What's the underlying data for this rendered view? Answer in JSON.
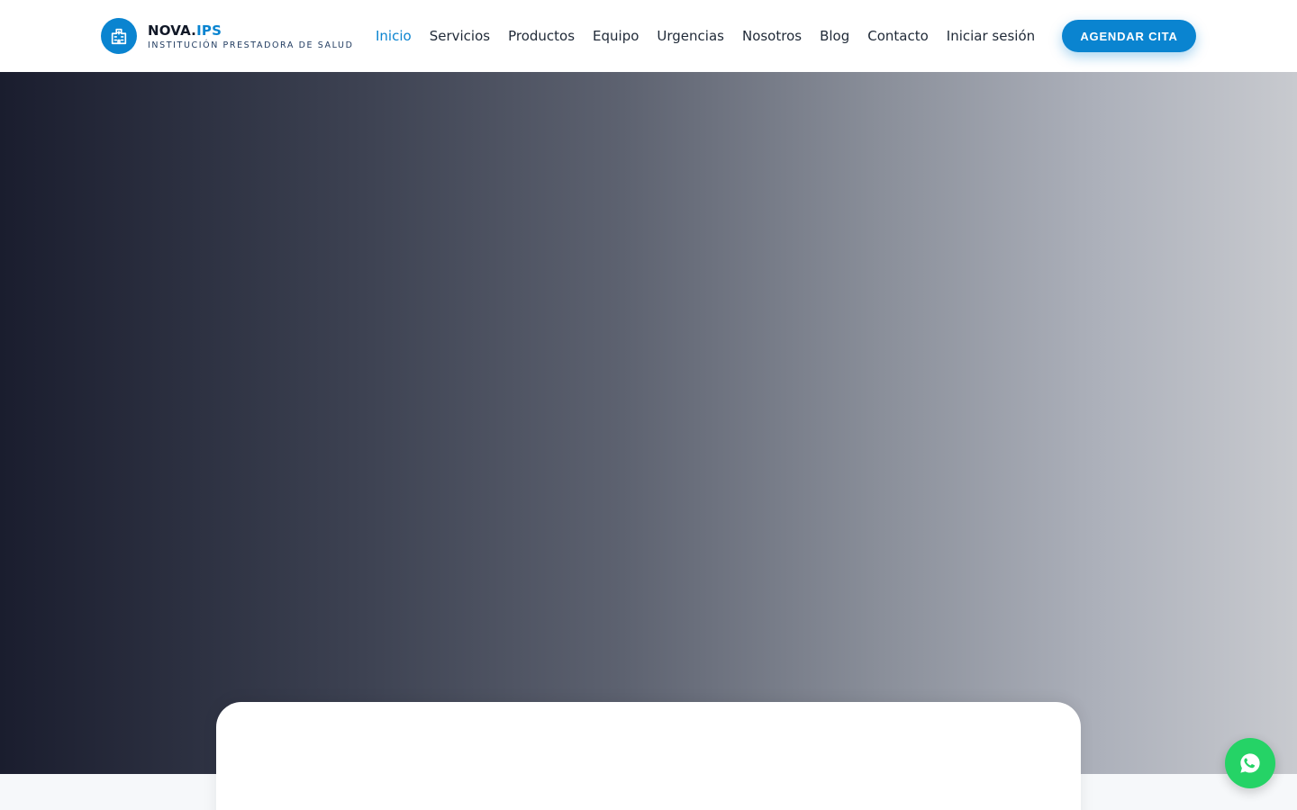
{
  "brand": {
    "name_main": "NOVA.",
    "name_accent": "IPS",
    "tagline": "INSTITUCIÓN PRESTADORA DE SALUD",
    "icon": "hospital-icon"
  },
  "nav": {
    "items": [
      {
        "label": "Inicio",
        "active": true
      },
      {
        "label": "Servicios",
        "active": false
      },
      {
        "label": "Productos",
        "active": false
      },
      {
        "label": "Equipo",
        "active": false
      },
      {
        "label": "Urgencias",
        "active": false
      },
      {
        "label": "Nosotros",
        "active": false
      },
      {
        "label": "Blog",
        "active": false
      },
      {
        "label": "Contacto",
        "active": false
      },
      {
        "label": "Iniciar sesión",
        "active": false
      }
    ],
    "cta_label": "AGENDAR CITA"
  },
  "floating": {
    "icon": "whatsapp-icon"
  },
  "colors": {
    "accent": "#0a84d0",
    "whatsapp": "#25d366",
    "hero_dark": "#1a1d2e",
    "hero_light": "#c8cacf"
  }
}
